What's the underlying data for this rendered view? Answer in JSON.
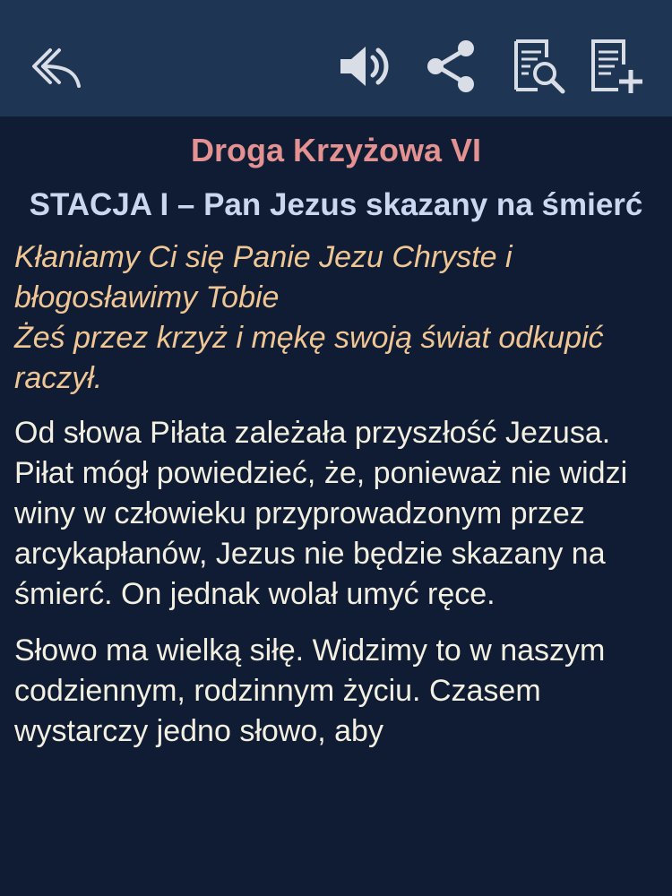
{
  "toolbar": {
    "back_icon": "reply-arrow-icon",
    "audio_icon": "speaker-icon",
    "share_icon": "share-icon",
    "search_icon": "document-search-icon",
    "add_icon": "document-add-icon"
  },
  "content": {
    "title": "Droga Krzyżowa VI",
    "station_heading": "STACJA I – Pan Jezus skazany na śmierć",
    "prayer_lines": [
      "Kłaniamy Ci się Panie Jezu Chryste i błogosławimy Tobie",
      "Żeś przez krzyż i mękę swoją świat odkupić raczył."
    ],
    "paragraphs": [
      "Od słowa Piłata zależała przyszłość Jezusa. Piłat mógł powiedzieć, że, ponieważ nie widzi winy w człowieku przyprowadzonym przez arcykapłanów, Jezus nie będzie skazany na śmierć. On jednak wolał umyć ręce.",
      "Słowo ma wielką siłę. Widzimy to w naszym codziennym, rodzinnym życiu. Czasem wystarczy jedno słowo, aby"
    ]
  },
  "colors": {
    "toolbar_bg": "#1e3554",
    "page_bg": "#0f1c33",
    "title": "#e49191",
    "station": "#cbd6f0",
    "prayer": "#f0c695",
    "body_text": "#f3f0e2",
    "icon": "#d8dde6"
  }
}
